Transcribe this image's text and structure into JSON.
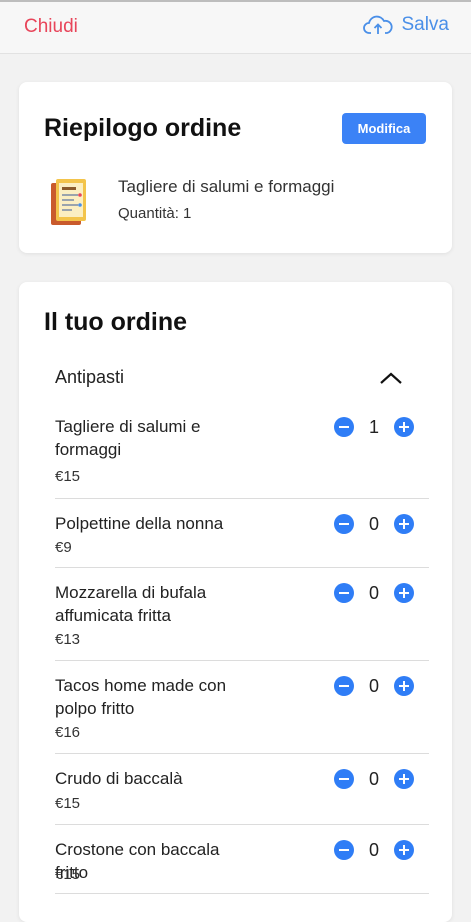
{
  "header": {
    "close_label": "Chiudi",
    "save_label": "Salva"
  },
  "summary": {
    "title": "Riepilogo ordine",
    "edit_label": "Modifica",
    "item_name": "Tagliere di salumi e formaggi",
    "quantity_text": "Quantità: 1"
  },
  "order": {
    "title": "Il tuo ordine",
    "section_label": "Antipasti",
    "items": [
      {
        "name": "Tagliere di salumi e formaggi",
        "price": "€15",
        "qty": "1"
      },
      {
        "name": "Polpettine della nonna",
        "price": "€9",
        "qty": "0"
      },
      {
        "name": "Mozzarella di bufala affumicata fritta",
        "price": "€13",
        "qty": "0"
      },
      {
        "name": "Tacos home made con polpo fritto",
        "price": "€16",
        "qty": "0"
      },
      {
        "name": "Crudo di baccalà",
        "price": "€15",
        "qty": "0"
      },
      {
        "name": "Crostone con baccala fritto",
        "price": "€15",
        "qty": "0"
      }
    ]
  },
  "colors": {
    "close": "#e8455a",
    "save": "#4a8fe8",
    "accent": "#3b82f6"
  },
  "icons": {
    "save": "cloud-upload-icon",
    "collapse": "chevron-up-icon",
    "minus": "minus-circle-icon",
    "plus": "plus-circle-icon",
    "menu": "menu-board-icon"
  }
}
